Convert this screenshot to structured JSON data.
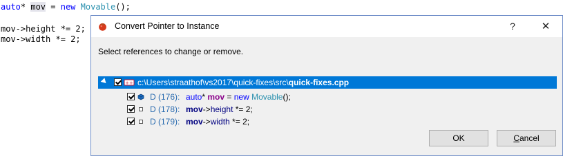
{
  "editor": {
    "line1": {
      "kw": "auto",
      "op1": "* ",
      "var": "mov",
      "op2": " = ",
      "new": "new",
      "sp": " ",
      "type": "Movable",
      "tail": "();"
    },
    "line2": "mov->height *= 2;",
    "line3": "mov->width *= 2;"
  },
  "dialog": {
    "title": "Convert Pointer to Instance",
    "help_label": "?",
    "close_label": "✕",
    "instruction": "Select references to change or remove.",
    "tree": {
      "root": {
        "path_prefix": "c:\\Users\\straathof\\vs2017\\quick-fixes\\src\\",
        "file_name": "quick-fixes.cpp",
        "checked": true
      },
      "children": [
        {
          "location": "D (176):",
          "code": {
            "a": "auto",
            "b": "* ",
            "c": "mov",
            "d": " = ",
            "e": "new",
            "f": " ",
            "g": "Movable",
            "h": "();"
          },
          "checked": true,
          "icon": "reference-declaration-icon"
        },
        {
          "location": "D (178):",
          "code": {
            "a": "mov",
            "b": "->",
            "c": "height",
            "d": " *= 2;"
          },
          "checked": true,
          "icon": "reference-usage-icon"
        },
        {
          "location": "D (179):",
          "code": {
            "a": "mov",
            "b": "->",
            "c": "width",
            "d": " *= 2;"
          },
          "checked": true,
          "icon": "reference-usage-icon"
        }
      ]
    },
    "ok_label": "OK",
    "cancel_label": {
      "underlined": "C",
      "rest": "ancel"
    }
  },
  "colors": {
    "selection": "#0078d7",
    "keyword": "#0000ff",
    "type": "#2b91af",
    "dialog_bg": "#f0f0f0"
  }
}
